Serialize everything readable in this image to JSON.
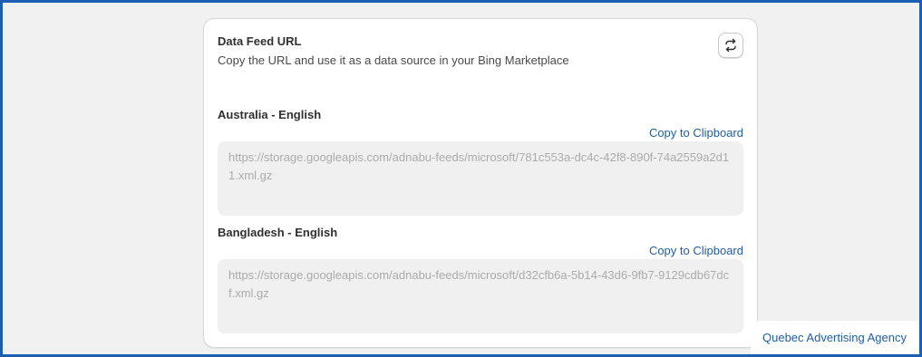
{
  "card": {
    "title": "Data Feed URL",
    "subtitle": "Copy the URL and use it as a data source in your Bing Marketplace",
    "refresh_icon": "refresh-icon"
  },
  "feeds": [
    {
      "label": "Australia - English",
      "copy_label": "Copy to Clipboard",
      "url": "https://storage.googleapis.com/adnabu-feeds/microsoft/781c553a-dc4c-42f8-890f-74a2559a2d11.xml.gz"
    },
    {
      "label": "Bangladesh - English",
      "copy_label": "Copy to Clipboard",
      "url": "https://storage.googleapis.com/adnabu-feeds/microsoft/d32cfb6a-5b14-43d6-9fb7-9129cdb67dcf.xml.gz"
    }
  ],
  "corner_link": "Quebec Advertising Agency",
  "colors": {
    "frame_border": "#1a5fb4",
    "link": "#1f5ea8",
    "page_bg": "#f1f1f1",
    "url_box_bg": "#f0f0f0"
  }
}
